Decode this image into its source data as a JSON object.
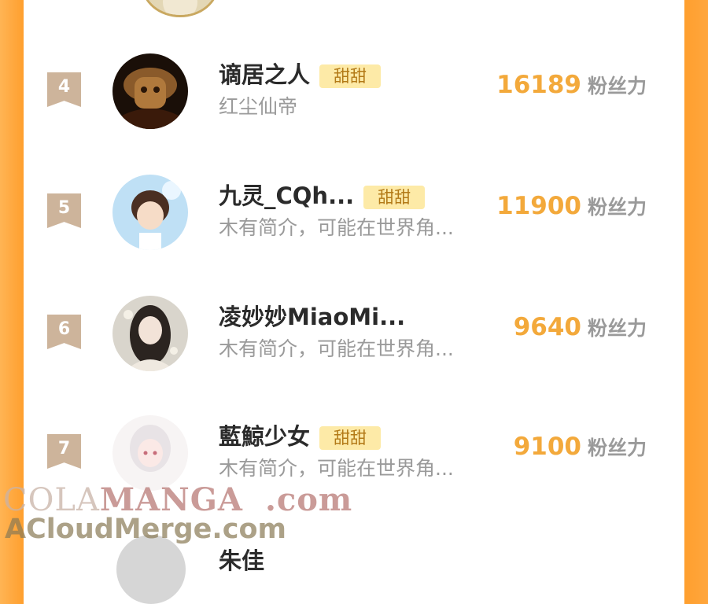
{
  "rows": [
    {
      "rank": "4",
      "name": "谪居之人",
      "tag": "甜甜",
      "bio": "红尘仙帝",
      "score": "16189",
      "unit": "粉丝力"
    },
    {
      "rank": "5",
      "name": "九灵_CQh...",
      "tag": "甜甜",
      "bio": "木有简介，可能在世界角...",
      "score": "11900",
      "unit": "粉丝力"
    },
    {
      "rank": "6",
      "name": "凌妙妙MiaoMi...",
      "tag": "",
      "bio": "木有简介，可能在世界角...",
      "score": "9640",
      "unit": "粉丝力"
    },
    {
      "rank": "7",
      "name": "藍鯨少女",
      "tag": "甜甜",
      "bio": "木有简介，可能在世界角...",
      "score": "9100",
      "unit": "粉丝力"
    }
  ],
  "partial_next": {
    "name": "朱佳"
  },
  "watermark": {
    "line1_prefix": "COLA",
    "line1_main": "MANGA",
    "line1_suffix": ".com",
    "line2": "ACloudMerge.com"
  },
  "colors": {
    "accent": "#f3a93b",
    "tag_bg": "#fdeaa7",
    "rank_badge": "#cdb49b",
    "border": "#ff9f2e"
  }
}
